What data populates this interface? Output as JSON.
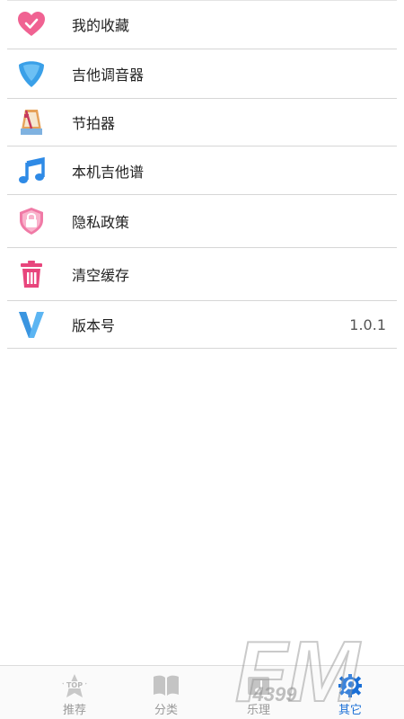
{
  "menu": {
    "items": [
      {
        "label": "我的收藏",
        "icon": "heart-check-icon"
      },
      {
        "label": "吉他调音器",
        "icon": "guitar-pick-icon"
      },
      {
        "label": "节拍器",
        "icon": "metronome-icon"
      },
      {
        "label": "本机吉他谱",
        "icon": "music-note-icon"
      },
      {
        "label": "隐私政策",
        "icon": "shield-lock-icon"
      },
      {
        "label": "清空缓存",
        "icon": "trash-icon"
      },
      {
        "label": "版本号",
        "icon": "version-v-icon",
        "value": "1.0.1"
      }
    ]
  },
  "tabs": [
    {
      "label": "推荐",
      "icon": "top-star-icon",
      "active": false
    },
    {
      "label": "分类",
      "icon": "book-icon",
      "active": false
    },
    {
      "label": "乐理",
      "icon": "music-theory-icon",
      "active": false
    },
    {
      "label": "其它",
      "icon": "gear-search-icon",
      "active": true
    }
  ],
  "watermark": {
    "text": "FM",
    "subtext": "4399"
  },
  "colors": {
    "accent": "#1a6fd6",
    "heart": "#f06292",
    "pick": "#3aa0e8",
    "trash": "#e8457c",
    "note": "#2e8ae6"
  }
}
